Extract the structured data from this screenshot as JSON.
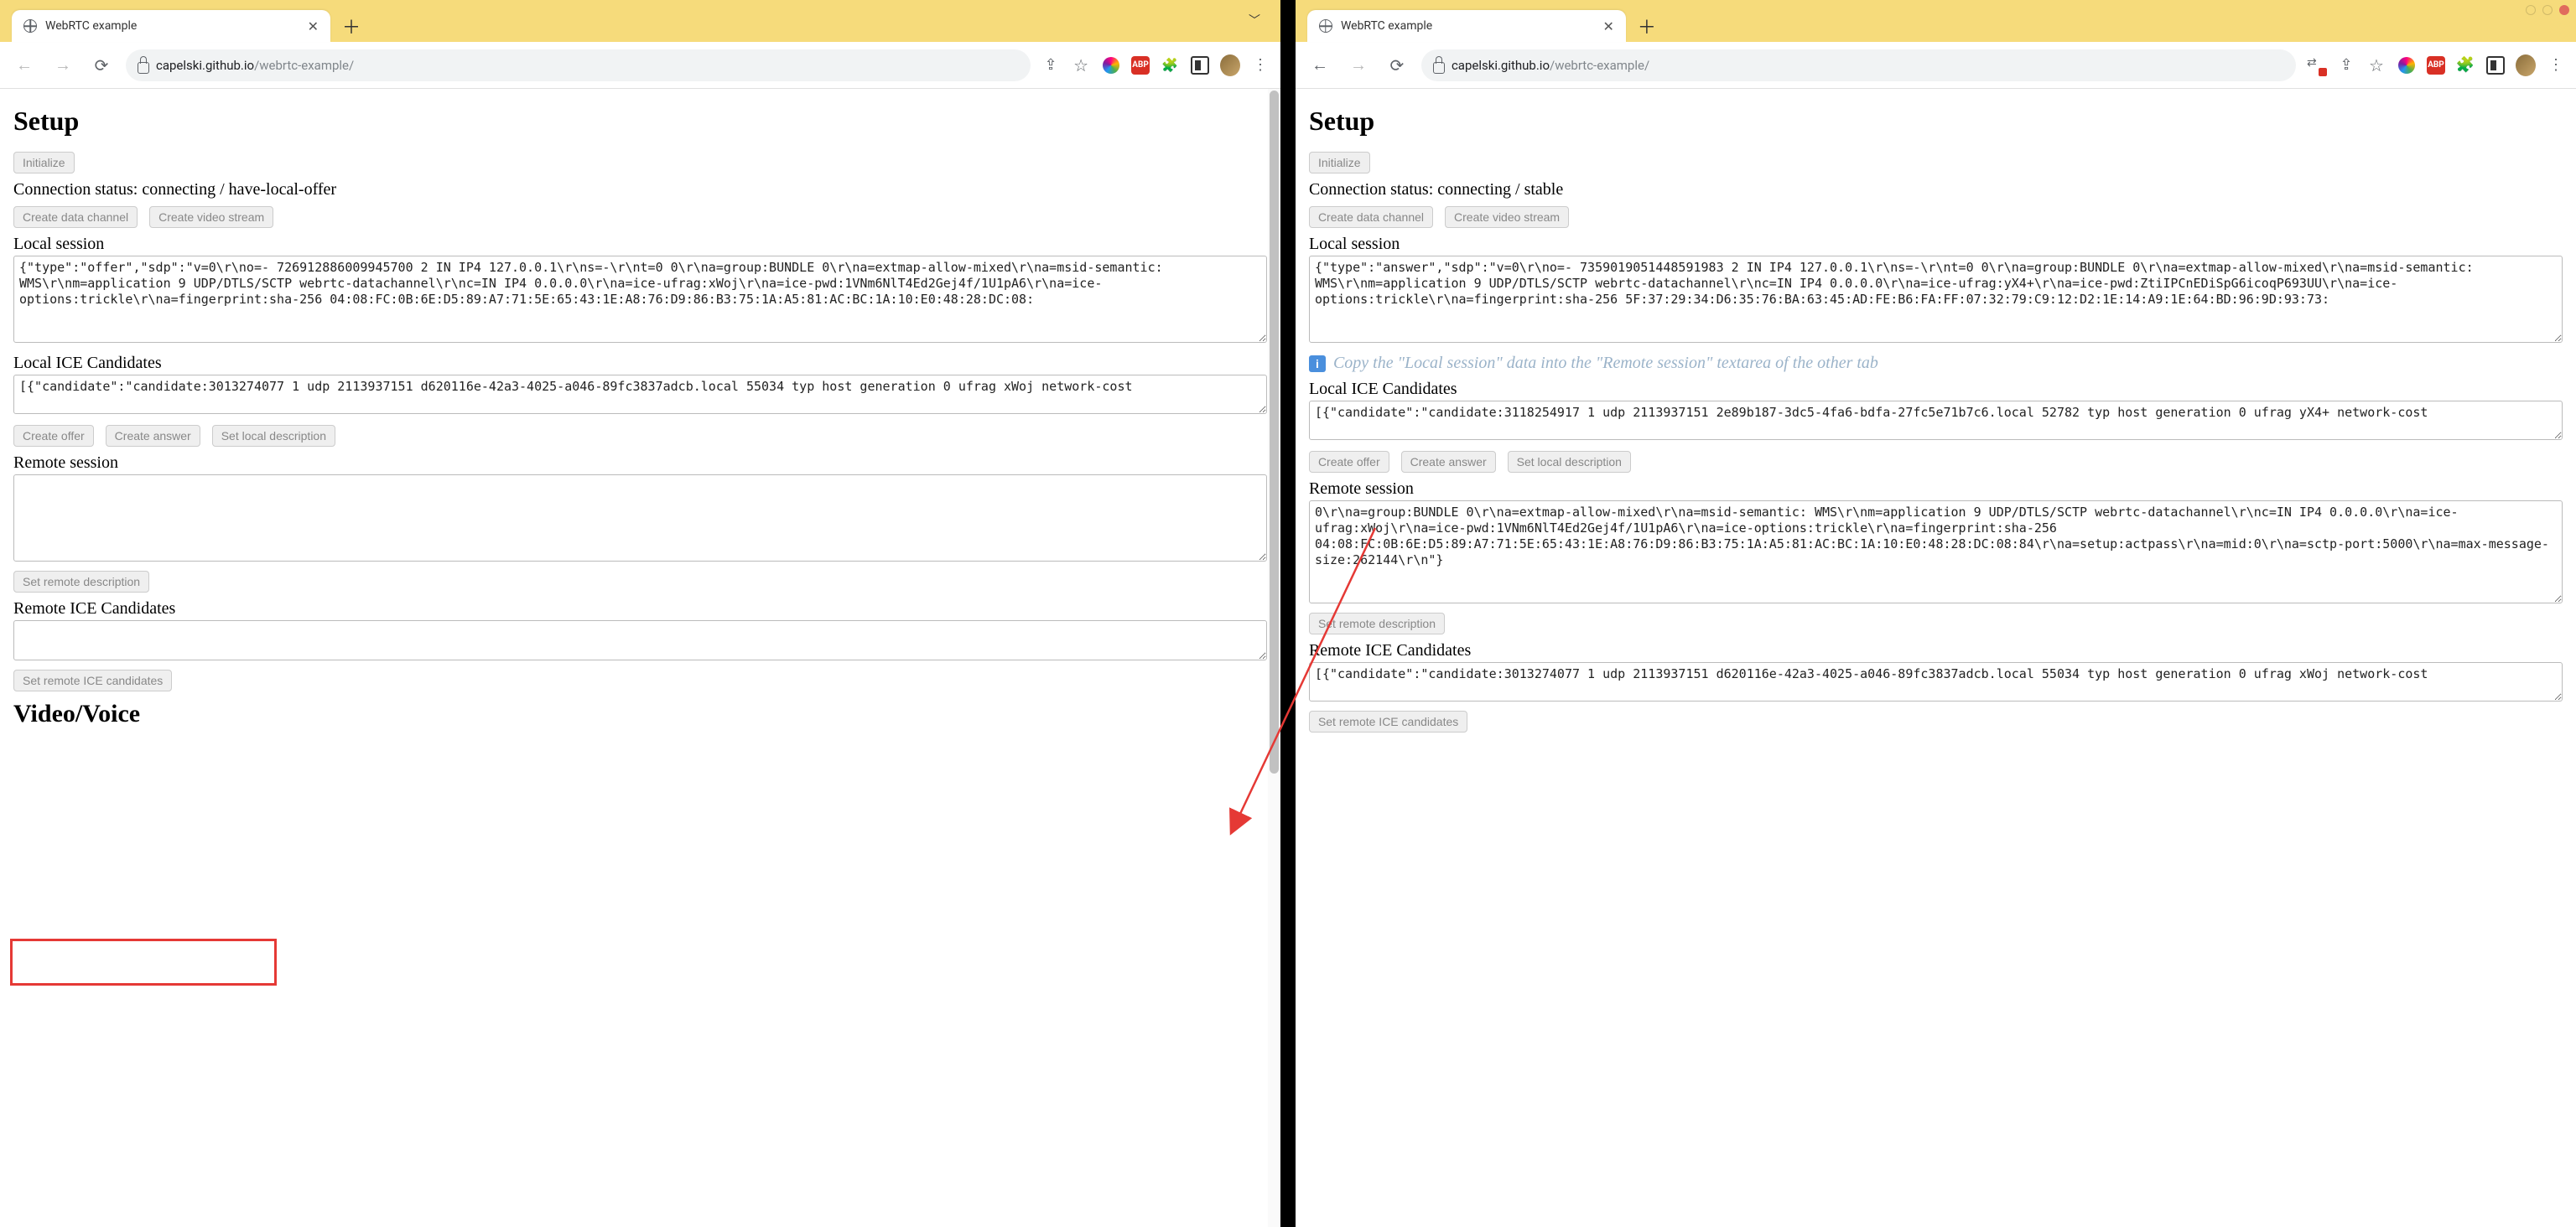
{
  "browser": {
    "tab_title": "WebRTC example",
    "url_host": "capelski.github.io",
    "url_path": "/webrtc-example/"
  },
  "labels": {
    "setup_heading": "Setup",
    "initialize": "Initialize",
    "conn_prefix": "Connection status: ",
    "create_data_channel": "Create data channel",
    "create_video_stream": "Create video stream",
    "local_session": "Local session",
    "local_ice": "Local ICE Candidates",
    "create_offer": "Create offer",
    "create_answer": "Create answer",
    "set_local_desc": "Set local description",
    "remote_session": "Remote session",
    "set_remote_desc": "Set remote description",
    "remote_ice": "Remote ICE Candidates",
    "set_remote_ice": "Set remote ICE candidates",
    "video_voice": "Video/Voice",
    "copy_hint": "Copy the \"Local session\" data into the \"Remote session\" textarea of the other tab"
  },
  "left": {
    "conn_status": "connecting / have-local-offer",
    "local_session": "{\"type\":\"offer\",\"sdp\":\"v=0\\r\\no=- 726912886009945700 2 IN IP4 127.0.0.1\\r\\ns=-\\r\\nt=0 0\\r\\na=group:BUNDLE 0\\r\\na=extmap-allow-mixed\\r\\na=msid-semantic: WMS\\r\\nm=application 9 UDP/DTLS/SCTP webrtc-datachannel\\r\\nc=IN IP4 0.0.0.0\\r\\na=ice-ufrag:xWoj\\r\\na=ice-pwd:1VNm6NlT4Ed2Gej4f/1U1pA6\\r\\na=ice-options:trickle\\r\\na=fingerprint:sha-256 04:08:FC:0B:6E:D5:89:A7:71:5E:65:43:1E:A8:76:D9:86:B3:75:1A:A5:81:AC:BC:1A:10:E0:48:28:DC:08:",
    "local_ice": "[{\"candidate\":\"candidate:3013274077 1 udp 2113937151 d620116e-42a3-4025-a046-89fc3837adcb.local 55034 typ host generation 0 ufrag xWoj network-cost",
    "remote_session": "",
    "remote_ice": ""
  },
  "right": {
    "conn_status": "connecting / stable",
    "local_session": "{\"type\":\"answer\",\"sdp\":\"v=0\\r\\no=- 7359019051448591983 2 IN IP4 127.0.0.1\\r\\ns=-\\r\\nt=0 0\\r\\na=group:BUNDLE 0\\r\\na=extmap-allow-mixed\\r\\na=msid-semantic: WMS\\r\\nm=application 9 UDP/DTLS/SCTP webrtc-datachannel\\r\\nc=IN IP4 0.0.0.0\\r\\na=ice-ufrag:yX4+\\r\\na=ice-pwd:ZtiIPCnEDiSpG6icoqP693UU\\r\\na=ice-options:trickle\\r\\na=fingerprint:sha-256 5F:37:29:34:D6:35:76:BA:63:45:AD:FE:B6:FA:FF:07:32:79:C9:12:D2:1E:14:A9:1E:64:BD:96:9D:93:73:",
    "local_ice": "[{\"candidate\":\"candidate:3118254917 1 udp 2113937151 2e89b187-3dc5-4fa6-bdfa-27fc5e71b7c6.local 52782 typ host generation 0 ufrag yX4+ network-cost",
    "remote_session": "0\\r\\na=group:BUNDLE 0\\r\\na=extmap-allow-mixed\\r\\na=msid-semantic: WMS\\r\\nm=application 9 UDP/DTLS/SCTP webrtc-datachannel\\r\\nc=IN IP4 0.0.0.0\\r\\na=ice-ufrag:xWoj\\r\\na=ice-pwd:1VNm6NlT4Ed2Gej4f/1U1pA6\\r\\na=ice-options:trickle\\r\\na=fingerprint:sha-256 04:08:FC:0B:6E:D5:89:A7:71:5E:65:43:1E:A8:76:D9:86:B3:75:1A:A5:81:AC:BC:1A:10:E0:48:28:DC:08:84\\r\\na=setup:actpass\\r\\na=mid:0\\r\\na=sctp-port:5000\\r\\na=max-message-size:262144\\r\\n\"}",
    "remote_ice": "[{\"candidate\":\"candidate:3013274077 1 udp 2113937151 d620116e-42a3-4025-a046-89fc3837adcb.local 55034 typ host generation 0 ufrag xWoj network-cost"
  }
}
